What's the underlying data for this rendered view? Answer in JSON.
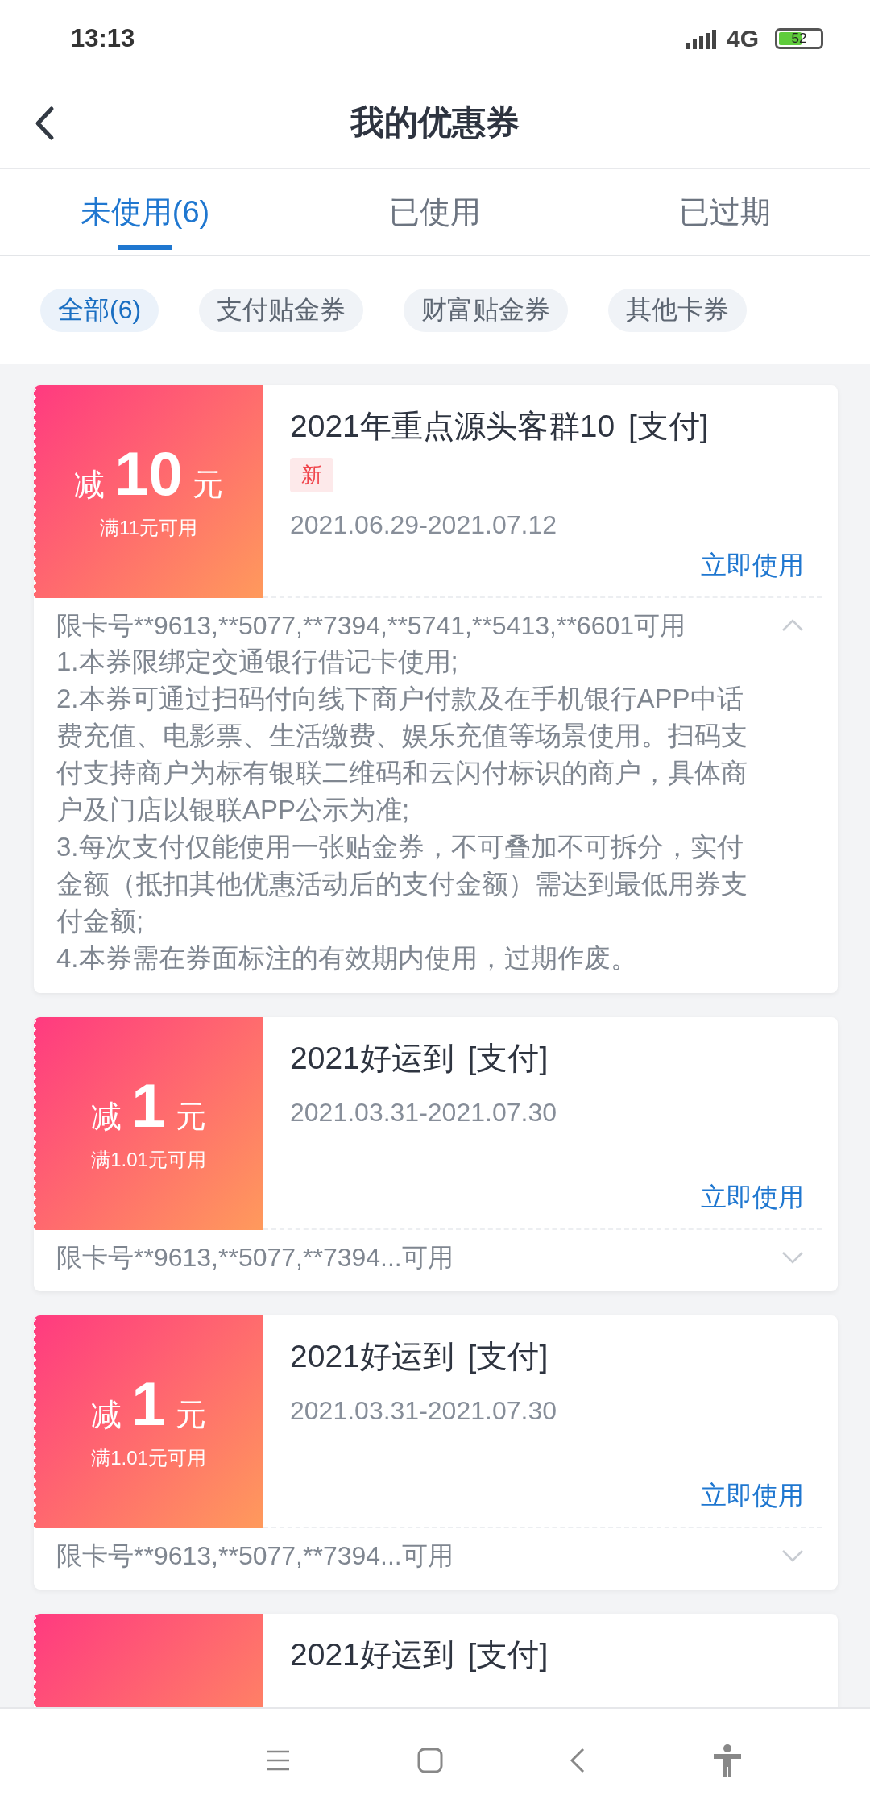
{
  "status_bar": {
    "time": "13:13",
    "network": "4G",
    "battery": "52"
  },
  "header": {
    "title": "我的优惠券"
  },
  "tabs": [
    {
      "label": "未使用(6)",
      "selected": true
    },
    {
      "label": "已使用",
      "selected": false
    },
    {
      "label": "已过期",
      "selected": false
    }
  ],
  "filters": [
    {
      "label": "全部(6)",
      "selected": true
    },
    {
      "label": "支付贴金券",
      "selected": false
    },
    {
      "label": "财富贴金券",
      "selected": false
    },
    {
      "label": "其他卡券",
      "selected": false
    }
  ],
  "coupons": [
    {
      "prefix": "减",
      "amount": "10",
      "unit": "元",
      "condition": "满11元可用",
      "title": "2021年重点源头客群10 [支付]",
      "badge": "新",
      "date": "2021.06.29-2021.07.12",
      "action": "立即使用",
      "cards": "限卡号**9613,**5077,**7394,**5741,**5413,**6601可用",
      "expanded": true,
      "rules": [
        "1.本券限绑定交通银行借记卡使用;",
        "2.本券可通过扫码付向线下商户付款及在手机银行APP中话费充值、电影票、生活缴费、娱乐充值等场景使用。扫码支付支持商户为标有银联二维码和云闪付标识的商户，具体商户及门店以银联APP公示为准;",
        "3.每次支付仅能使用一张贴金券，不可叠加不可拆分，实付金额（抵扣其他优惠活动后的支付金额）需达到最低用券支付金额;",
        "4.本券需在券面标注的有效期内使用，过期作废。"
      ]
    },
    {
      "prefix": "减",
      "amount": "1",
      "unit": "元",
      "condition": "满1.01元可用",
      "title": "2021好运到 [支付]",
      "date": "2021.03.31-2021.07.30",
      "action": "立即使用",
      "cards": "限卡号**9613,**5077,**7394...可用",
      "expanded": false
    },
    {
      "prefix": "减",
      "amount": "1",
      "unit": "元",
      "condition": "满1.01元可用",
      "title": "2021好运到 [支付]",
      "date": "2021.03.31-2021.07.30",
      "action": "立即使用",
      "cards": "限卡号**9613,**5077,**7394...可用",
      "expanded": false
    },
    {
      "title": "2021好运到 [支付]"
    }
  ]
}
